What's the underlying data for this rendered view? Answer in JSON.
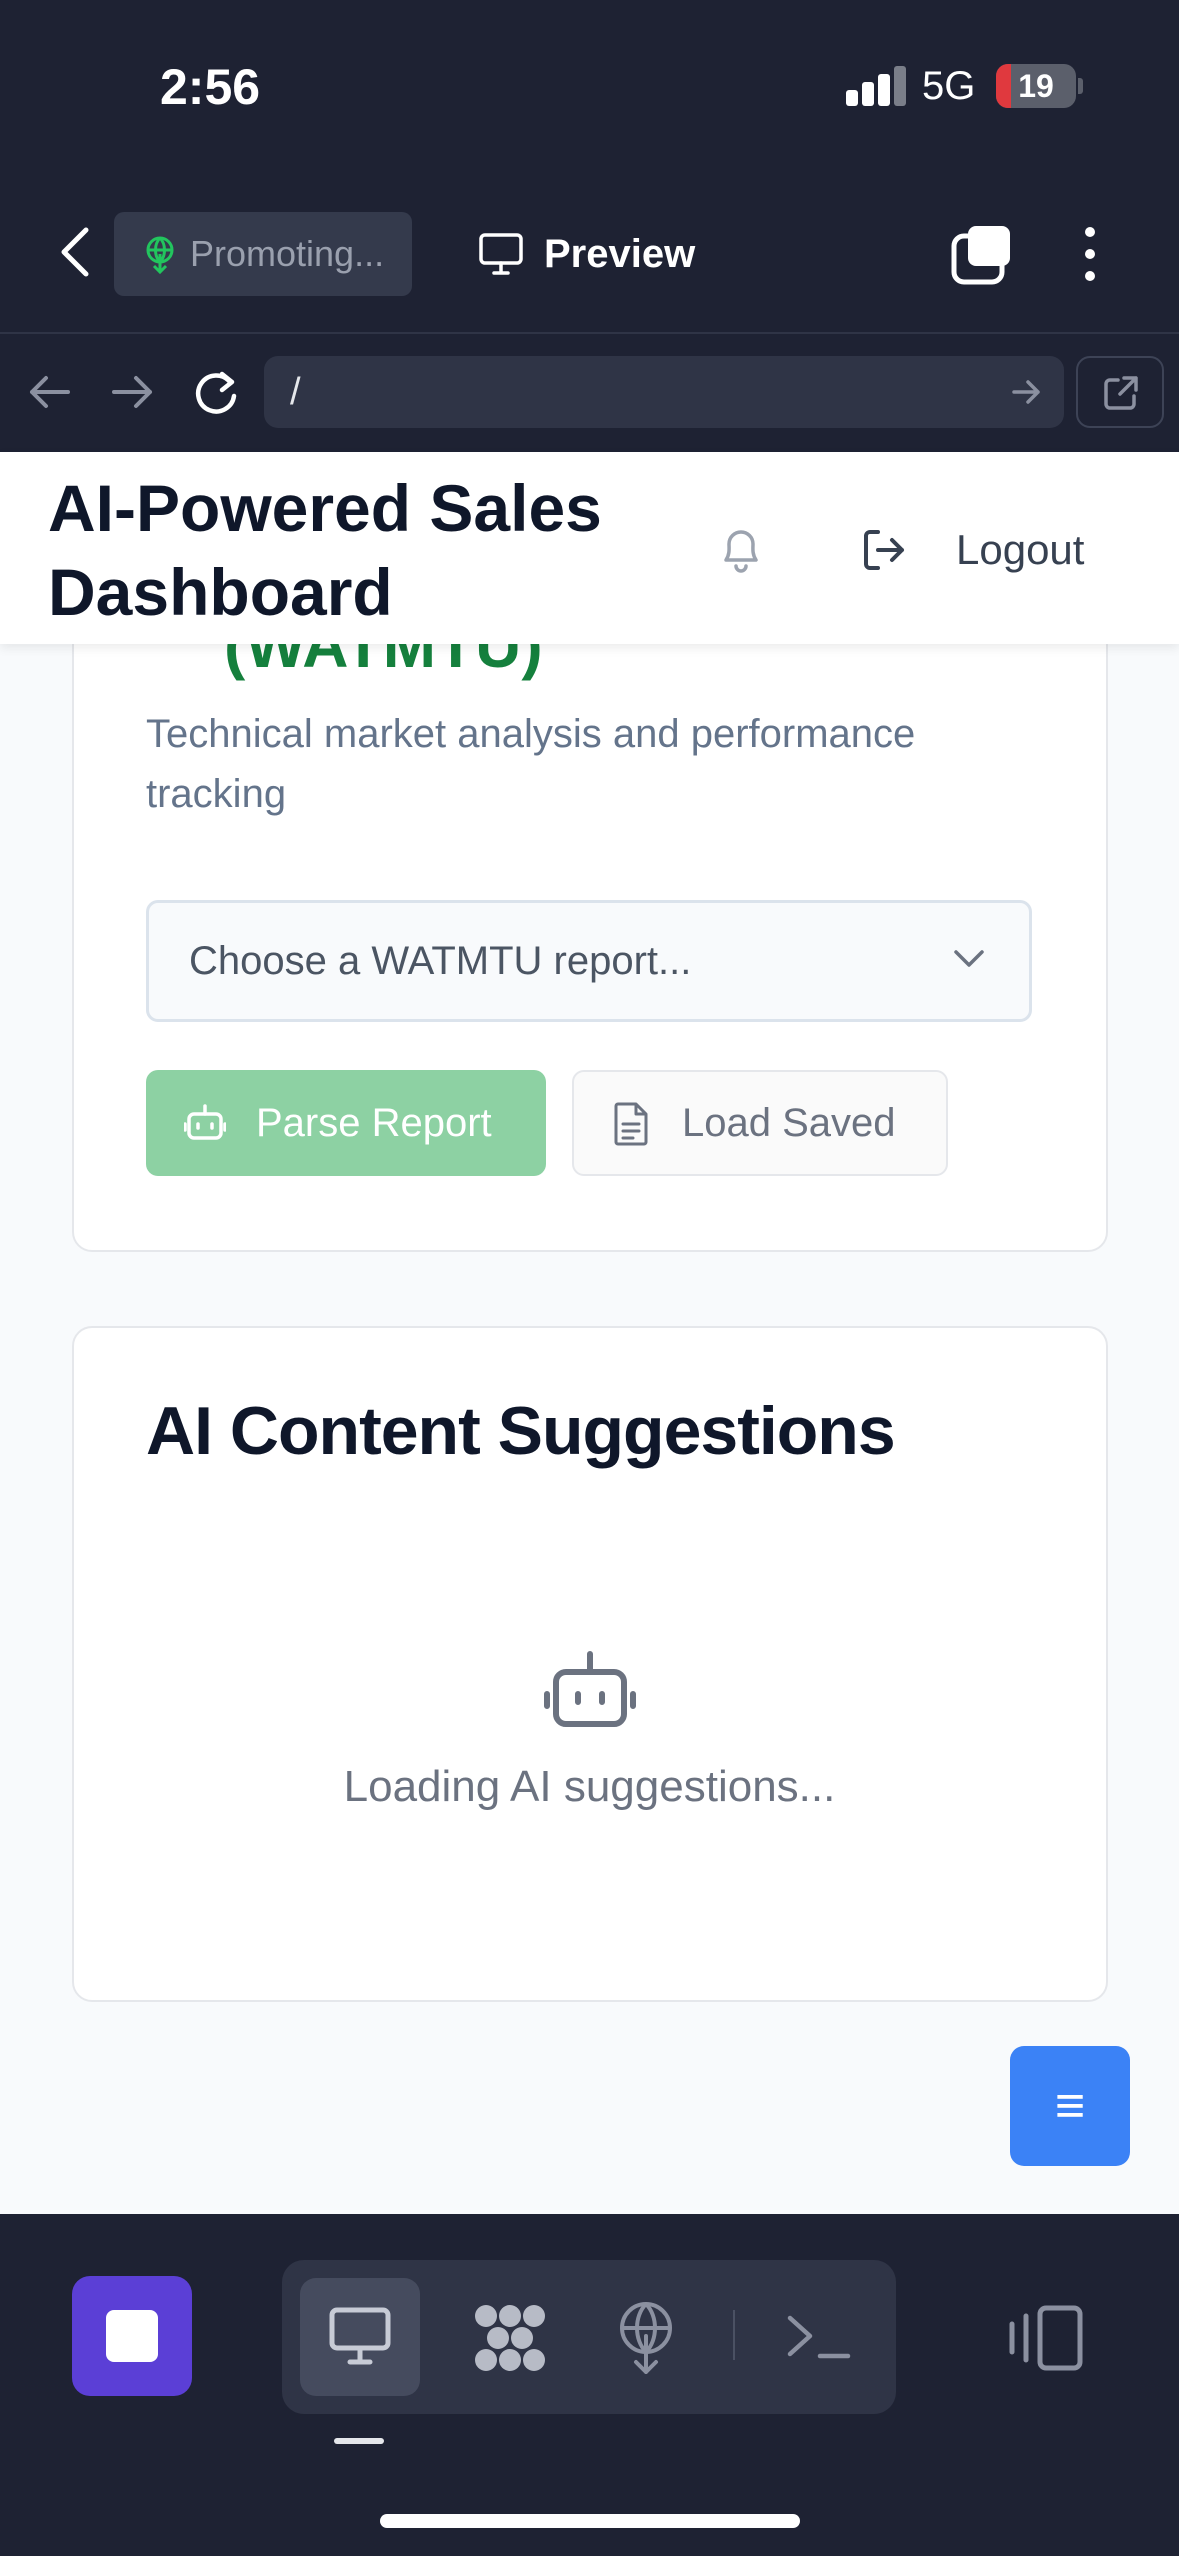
{
  "status_bar": {
    "time": "2:56",
    "network": "5G",
    "battery": "19",
    "battery_level": 0.19
  },
  "browser": {
    "project_pill_label": "Promoting...",
    "preview_label": "Preview",
    "url": "/"
  },
  "header": {
    "title": "AI-Powered Sales Dashboard",
    "logout_label": "Logout"
  },
  "report_card": {
    "heading_partial": "(WATMTU)",
    "description": "Technical market analysis and performance tracking",
    "select_placeholder": "Choose a WATMTU report...",
    "parse_button": "Parse Report",
    "load_button": "Load Saved"
  },
  "suggestions_card": {
    "title": "AI Content Suggestions",
    "loading_text": "Loading AI suggestions..."
  },
  "fab_icon": "menu-icon",
  "colors": {
    "chrome_bg": "#1e2233",
    "accent_green": "#15803d",
    "parse_button_bg": "#8dd1a3",
    "fab_bg": "#3b82f6",
    "stop_button_bg": "#5b3fd6"
  }
}
